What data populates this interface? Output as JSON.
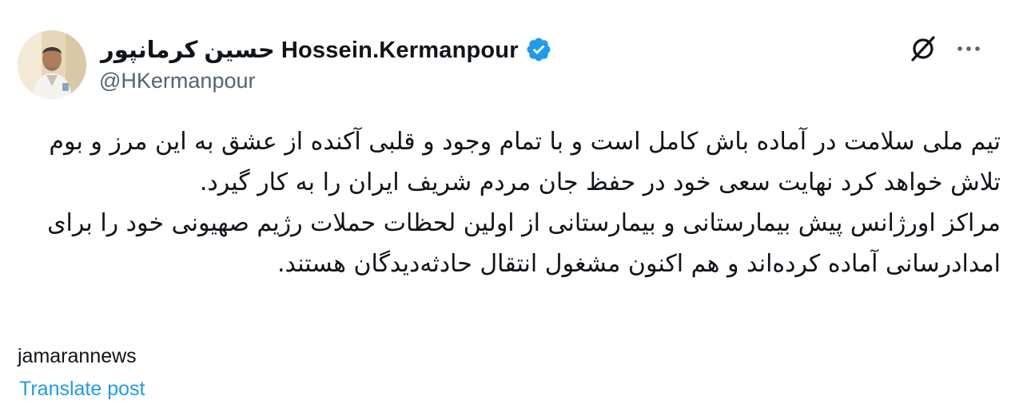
{
  "author": {
    "display_name": "حسین کرمانپور Hossein.Kermanpour",
    "handle": "@HKermanpour",
    "verified": true,
    "verified_color": "#1d9bf0"
  },
  "actions": {
    "grok_icon": "grok-icon",
    "more_icon": "more-icon"
  },
  "post": {
    "paragraph_1": "تیم ملی سلامت  در آماده باش کامل است و با تمام وجود و قلبی آکنده از عشق به این مرز و بوم تلاش خواهد کرد نهایت سعی خود در حفظ جان مردم شریف ایران را به کار گیرد.",
    "paragraph_2": "مراکز اورژانس پیش بیمارستانی و بیمارستانی از اولین لحظات حملات رژیم صهیونی خود را برای امدادرسانی آماده کرده‌اند و هم اکنون مشغول انتقال حادثه‌دیدگان هستند."
  },
  "source_label": "jamarannews",
  "translate_label": "Translate post",
  "colors": {
    "text": "#0f1419",
    "secondary": "#536471",
    "link": "#1d9bf0"
  }
}
